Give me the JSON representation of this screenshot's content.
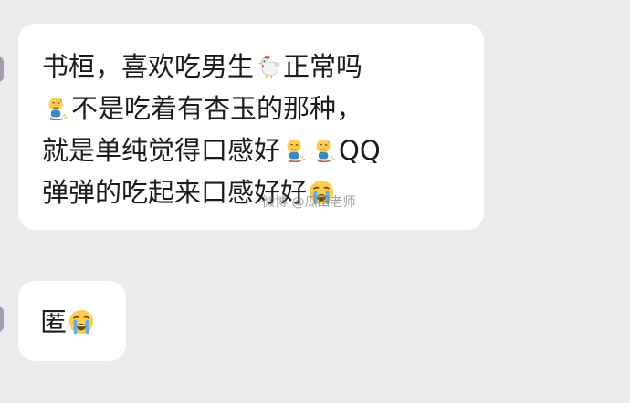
{
  "messages": [
    {
      "lines": [
        [
          "书桓，喜欢吃男生",
          {
            "icon": "rooster-emoji"
          },
          "正常吗"
        ],
        [
          {
            "icon": "kneeling-sweat-emoji"
          },
          "不是吃着有杏玉的那种，"
        ],
        [
          "就是单纯觉得口感好",
          {
            "icon": "kneeling-sweat-emoji"
          },
          {
            "icon": "kneeling-sweat-emoji"
          },
          "QQ"
        ],
        [
          "弹弹的吃起来口感好好",
          {
            "icon": "loudly-crying-emoji"
          }
        ]
      ]
    },
    {
      "lines": [
        [
          "匿",
          {
            "icon": "loudly-crying-emoji"
          }
        ]
      ]
    }
  ],
  "watermark": "微博 @瓜田老师"
}
